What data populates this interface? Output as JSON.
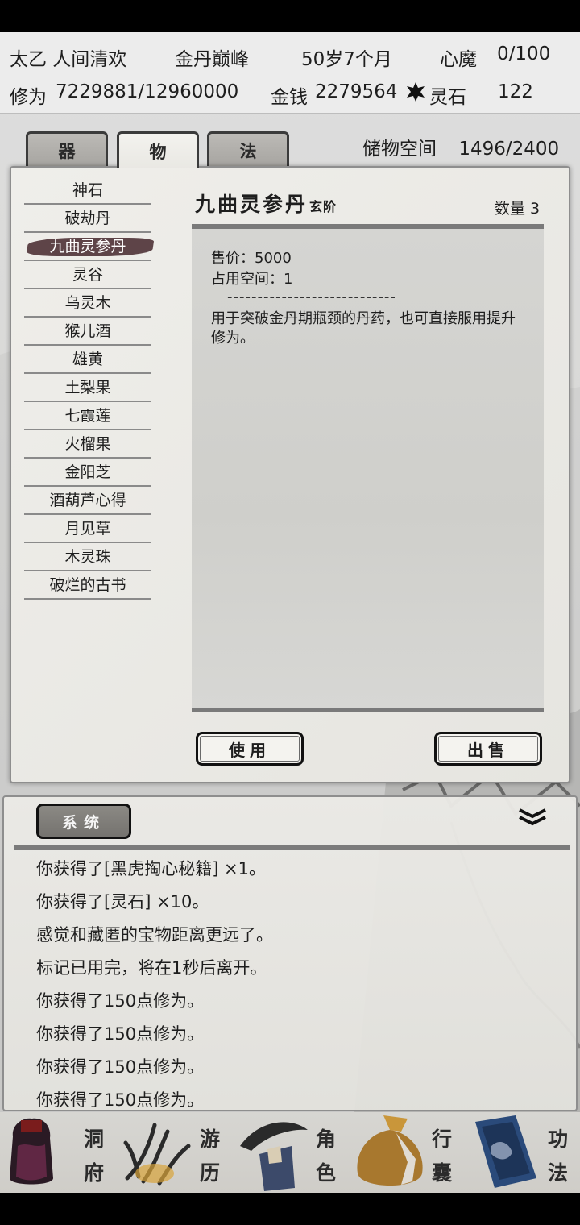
{
  "header": {
    "name": "太乙 人间清欢",
    "realm": "金丹巅峰",
    "age": "50岁7个月",
    "demon_label": "心魔",
    "demon_value": "0/100",
    "cultivation_label": "修为",
    "cultivation_value": "7229881/12960000",
    "money_label": "金钱",
    "money_value": "2279564",
    "spirit_stone_label": "灵石",
    "spirit_stone_value": "122"
  },
  "tabs": [
    {
      "label": "器"
    },
    {
      "label": "物"
    },
    {
      "label": "法"
    }
  ],
  "storage": {
    "label": "储物空间",
    "value": "1496/2400"
  },
  "items": [
    {
      "label": "神石"
    },
    {
      "label": "破劫丹"
    },
    {
      "label": "九曲灵参丹"
    },
    {
      "label": "灵谷"
    },
    {
      "label": "乌灵木"
    },
    {
      "label": "猴儿酒"
    },
    {
      "label": "雄黄"
    },
    {
      "label": "土梨果"
    },
    {
      "label": "七霞莲"
    },
    {
      "label": "火榴果"
    },
    {
      "label": "金阳芝"
    },
    {
      "label": "酒葫芦心得"
    },
    {
      "label": "月见草"
    },
    {
      "label": "木灵珠"
    },
    {
      "label": "破烂的古书"
    }
  ],
  "detail": {
    "title": "九曲灵参丹",
    "grade": "玄阶",
    "qty_label": "数量",
    "qty_value": "3",
    "price": "售价：5000",
    "space": "占用空间：1",
    "separator": "----------------------------",
    "description": "用于突破金丹期瓶颈的丹药，也可直接服用提升修为。",
    "use_label": "使用",
    "sell_label": "出售"
  },
  "log": {
    "tab_label": "系统",
    "lines": [
      "你获得了[黑虎掏心秘籍] ×1。",
      "你获得了[灵石] ×10。",
      "感觉和藏匿的宝物距离更远了。",
      "标记已用完，将在1秒后离开。",
      "你获得了150点修为。",
      "你获得了150点修为。",
      "你获得了150点修为。",
      "你获得了150点修为。"
    ]
  },
  "nav": [
    {
      "label_a": "洞",
      "label_b": "府",
      "icon": "cave-icon"
    },
    {
      "label_a": "游",
      "label_b": "历",
      "icon": "travel-icon"
    },
    {
      "label_a": "角",
      "label_b": "色",
      "icon": "character-icon"
    },
    {
      "label_a": "行",
      "label_b": "囊",
      "icon": "bag-icon"
    },
    {
      "label_a": "功",
      "label_b": "法",
      "icon": "scroll-book-icon"
    }
  ],
  "colors": {
    "selected_item": "#5e4448",
    "panel_bg": "#eceae6",
    "frame": "#111111"
  }
}
